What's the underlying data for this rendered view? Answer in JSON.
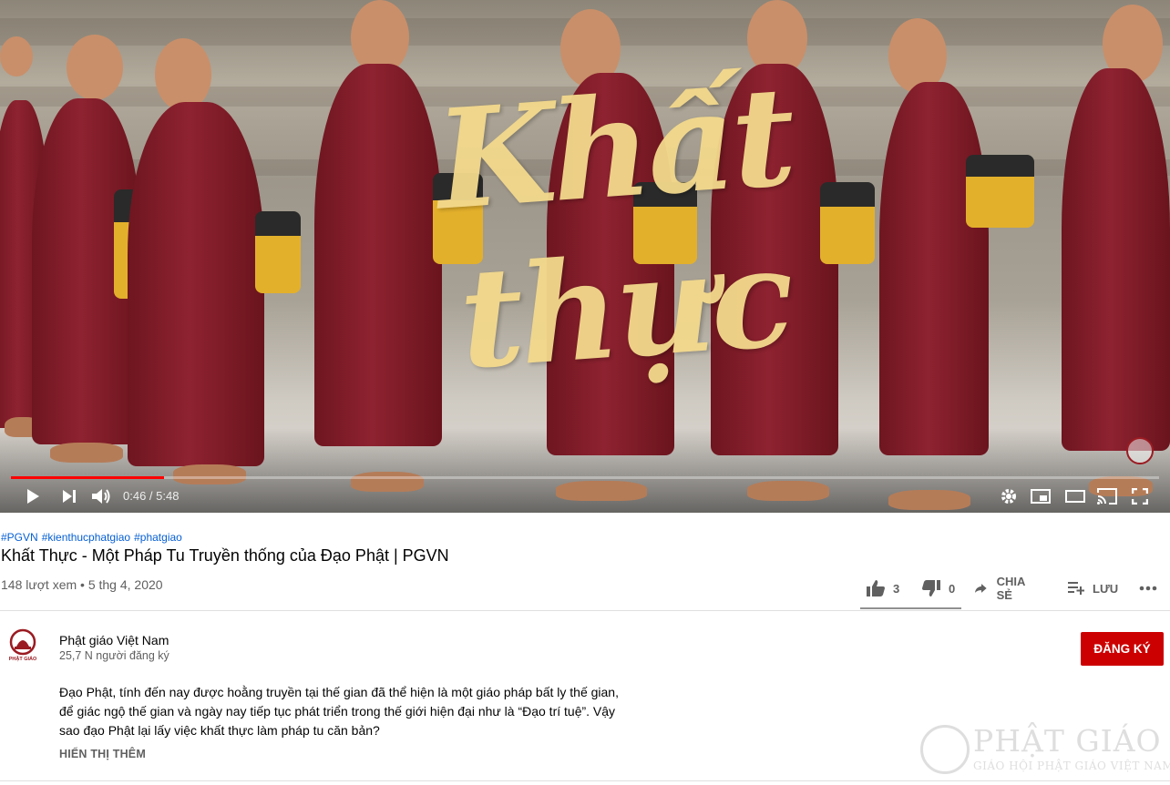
{
  "video": {
    "overlay_title": "Khất thực",
    "time_current": "0:46",
    "time_separator": " / ",
    "time_total": "5:48",
    "progress_fraction": 0.133,
    "colors": {
      "progress": "#ff0000",
      "overlay_text": "#f3d98c",
      "robe": "#8e2230"
    },
    "controls": [
      "play-icon",
      "next-icon",
      "volume-icon",
      "settings-icon",
      "miniplayer-icon",
      "theater-icon",
      "cast-icon",
      "fullscreen-icon"
    ]
  },
  "meta": {
    "hashtags": [
      "#PGVN",
      "#kienthucphatgiao",
      "#phatgiao"
    ],
    "title": "Khất Thực - Một Pháp Tu Truyền thống của Đạo Phật | PGVN",
    "views": "148 lượt xem",
    "separator": "•",
    "date": "5 thg 4, 2020"
  },
  "actions": {
    "likes": "3",
    "dislikes": "0",
    "share_label": "CHIA SẺ",
    "save_label": "LƯU",
    "more_icon": "more-horiz-icon"
  },
  "channel": {
    "name": "Phật giáo Việt Nam",
    "subscribers": "25,7 N người đăng ký",
    "subscribe_label": "ĐĂNG KÝ",
    "avatar_text": "PHẬT GIÁO",
    "colors": {
      "subscribe": "#cc0000"
    }
  },
  "description": {
    "text": "Đạo Phật, tính đến nay được hoằng truyền tại thế gian đã thể hiện là một giáo pháp bất ly thế gian, để giác ngộ thế gian và ngày nay tiếp tục phát triển trong thế giới hiện đại như là “Đạo trí tuệ”. Vậy sao đạo Phật lại lấy việc khất thực làm pháp tu căn bản?",
    "show_more": "HIỂN THỊ THÊM"
  },
  "watermark": {
    "title": "PHẬT GIÁO",
    "subtitle": "GIÁO HỘI PHẬT GIÁO VIỆT NAM"
  }
}
